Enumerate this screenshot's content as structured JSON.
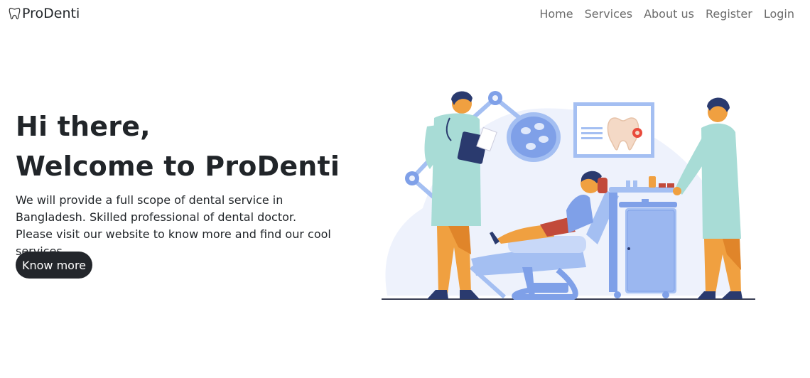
{
  "brand": {
    "name": "ProDenti",
    "icon": "tooth-icon"
  },
  "nav": {
    "items": [
      {
        "label": "Home"
      },
      {
        "label": "Services"
      },
      {
        "label": "About us"
      },
      {
        "label": "Register"
      },
      {
        "label": "Login"
      }
    ]
  },
  "hero": {
    "title_line1": "Hi there,",
    "title_line2": "Welcome to ProDenti",
    "description": "We will provide a full scope of dental service in Bangladesh. Skilled professional of dental doctor. Please visit our website to know more and find our cool services.",
    "button_label": "Know more"
  },
  "colors": {
    "button_bg": "#23262b",
    "nav_text": "#6c6c6c",
    "illustration_blue": "#9bb7f0",
    "illustration_orange": "#f0a040",
    "illustration_teal": "#a8dcd6"
  }
}
